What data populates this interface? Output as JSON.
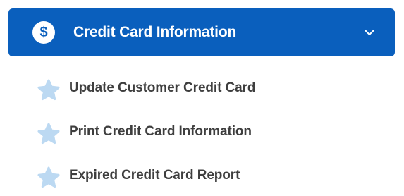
{
  "header": {
    "title": "Credit Card Information",
    "icon": "dollar-icon",
    "icon_glyph": "$",
    "expanded_icon": "chevron-down-icon",
    "accent_color": "#0a5fbd"
  },
  "submenu": {
    "items": [
      {
        "label": "Update Customer Credit Card",
        "icon": "star-icon"
      },
      {
        "label": "Print Credit Card Information",
        "icon": "star-icon"
      },
      {
        "label": "Expired Credit Card Report",
        "icon": "star-icon"
      }
    ],
    "icon_color": "#bcd9f2"
  }
}
